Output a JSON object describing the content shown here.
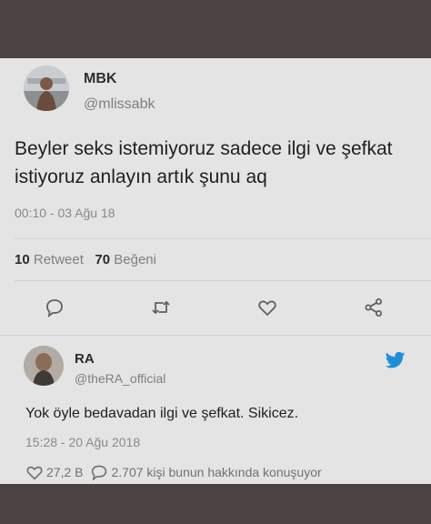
{
  "tweet": {
    "display_name": "MBK",
    "handle": "@mlissabk",
    "text": "Beyler seks istemiyoruz sadece ilgi ve şefkat istiyoruz anlayın artık şunu aq",
    "timestamp": "00:10 - 03 Ağu 18",
    "retweet_count": "10",
    "retweet_label": "Retweet",
    "like_count": "70",
    "like_label": "Beğeni",
    "actions": [
      "reply-icon",
      "retweet-icon",
      "like-icon",
      "share-icon"
    ]
  },
  "reply": {
    "display_name": "RA",
    "handle": "@theRA_official",
    "text": "Yok öyle bedavadan ilgi ve şefkat. Sikicez.",
    "timestamp": "15:28 - 20 Ağu 2018",
    "likes": "27,2 B",
    "comments_text": "2.707 kişi bunun hakkında konuşuyor"
  },
  "colors": {
    "card_background": "#e4e4e4",
    "frame_background": "#4a4341",
    "twitter_blue": "#1d8fd8",
    "muted_text": "#878a8e"
  }
}
